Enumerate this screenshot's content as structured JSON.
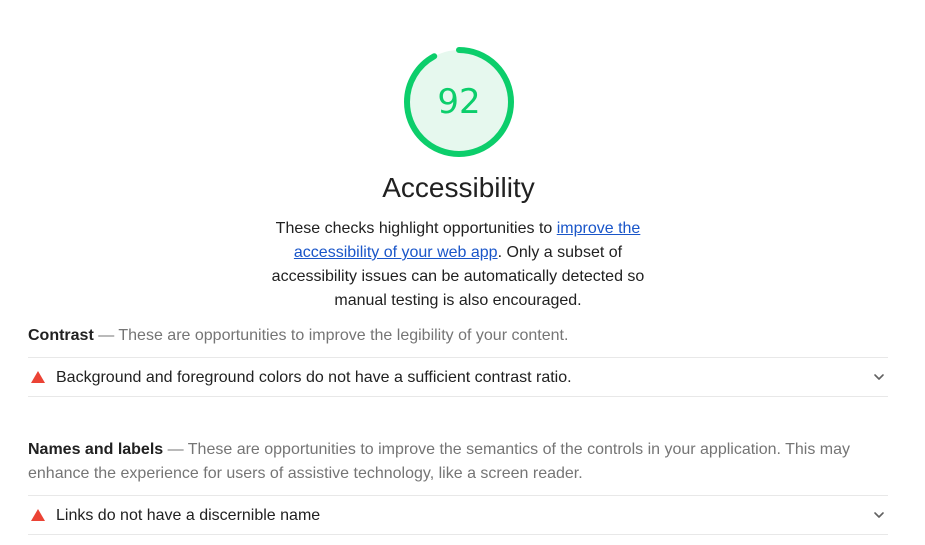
{
  "gauge": {
    "score": "92",
    "fraction": 0.92,
    "color": "#0cce6b",
    "fill_color": "#e6f8ee"
  },
  "category": {
    "title": "Accessibility",
    "desc_before": "These checks highlight opportunities to ",
    "link_text": "improve the accessibility of your web app",
    "desc_after": ". Only a subset of accessibility issues can be automatically detected so manual testing is also encouraged."
  },
  "groups": [
    {
      "title": "Contrast",
      "description": " — These are opportunities to improve the legibility of your content.",
      "audits": [
        {
          "title": "Background and foreground colors do not have a sufficient contrast ratio.",
          "status": "fail"
        }
      ]
    },
    {
      "title": "Names and labels",
      "description": " — These are opportunities to improve the semantics of the controls in your application. This may enhance the experience for users of assistive technology, like a screen reader.",
      "audits": [
        {
          "title": "Links do not have a discernible name",
          "status": "fail"
        }
      ]
    }
  ],
  "colors": {
    "pass": "#0cce6b",
    "fail": "#eb4335",
    "link": "#1a56c9"
  },
  "icons": {
    "fail": "warning-triangle-icon",
    "expand": "chevron-down-icon"
  }
}
